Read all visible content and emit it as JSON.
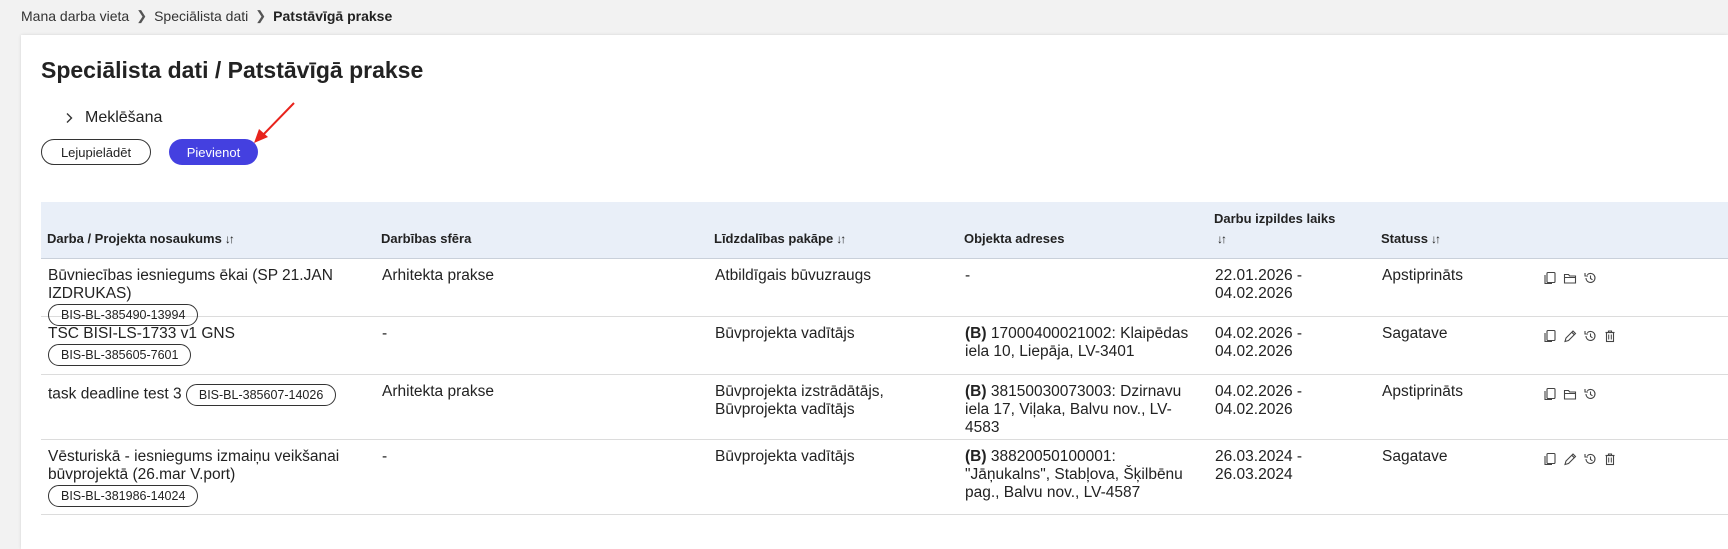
{
  "breadcrumb": [
    "Mana darba vieta",
    "Speciālista dati",
    "Patstāvīgā prakse"
  ],
  "page_title": "Speciālista dati / Patstāvīgā prakse",
  "search_toggle_label": "Meklēšana",
  "buttons": {
    "download": "Lejupielādēt",
    "add": "Pievienot"
  },
  "table": {
    "headers": {
      "name": "Darba / Projekta nosaukums",
      "sphere": "Darbības sfēra",
      "level": "Līdzdalības pakāpe",
      "address": "Objekta adreses",
      "period": "Darbu izpildes laiks",
      "status": "Statuss"
    },
    "sort_glyph": "↓↑",
    "rows": [
      {
        "name": "Būvniecības iesniegums ēkai (SP 21.JAN IZDRUKAS)",
        "badge": "BIS-BL-385490-13994",
        "sphere": "Arhitekta prakse",
        "level": "Atbildīgais būvuzraugs",
        "address_prefix": "",
        "address": "-",
        "period": "22.01.2026 - 04.02.2026",
        "status": "Apstiprināts",
        "actions": [
          "copy-icon",
          "folder-icon",
          "history-icon"
        ]
      },
      {
        "name": "TSC BISI-LS-1733 v1 GNS",
        "badge": "BIS-BL-385605-7601",
        "sphere": "-",
        "level": "Būvprojekta vadītājs",
        "address_prefix": "(B)",
        "address": "17000400021002: Klaipēdas iela 10, Liepāja, LV-3401",
        "period": "04.02.2026 - 04.02.2026",
        "status": "Sagatave",
        "actions": [
          "copy-icon",
          "edit-icon",
          "history-icon",
          "trash-icon"
        ]
      },
      {
        "name": "task deadline test 3",
        "badge": "BIS-BL-385607-14026",
        "sphere": "Arhitekta prakse",
        "level": "Būvprojekta izstrādātājs, Būvprojekta vadītājs",
        "address_prefix": "(B)",
        "address": "38150030073003: Dzirnavu iela 17, Viļaka, Balvu nov., LV-4583",
        "period": "04.02.2026 - 04.02.2026",
        "status": "Apstiprināts",
        "actions": [
          "copy-icon",
          "folder-icon",
          "history-icon"
        ]
      },
      {
        "name": "Vēsturiskā - iesniegums izmaiņu veikšanai būvprojektā (26.mar V.port)",
        "badge": "BIS-BL-381986-14024",
        "sphere": "-",
        "level": "Būvprojekta vadītājs",
        "address_prefix": "(B)",
        "address": "38820050100001: \"Jāņukalns\", Stabļova, Šķilbēnu pag., Balvu nov., LV-4587",
        "period": "26.03.2024 - 26.03.2024",
        "status": "Sagatave",
        "actions": [
          "copy-icon",
          "edit-icon",
          "history-icon",
          "trash-icon"
        ]
      }
    ]
  },
  "colors": {
    "primary": "#4440e0",
    "header_bg": "#e9eff8",
    "annotation_arrow": "#e8231c"
  }
}
